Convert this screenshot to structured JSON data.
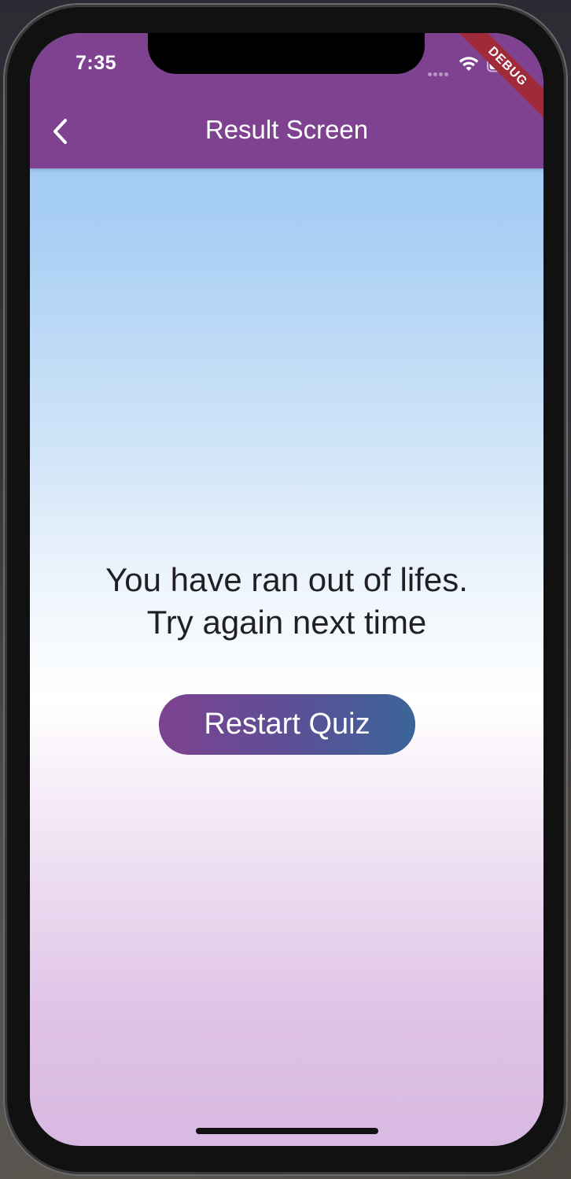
{
  "status_bar": {
    "time": "7:35"
  },
  "debug_banner": "DEBUG",
  "appbar": {
    "title": "Result Screen",
    "back_icon": "chevron-left-icon"
  },
  "message": {
    "line1": "You have ran out of lifes.",
    "line2": "Try again next time"
  },
  "restart_button": {
    "label": "Restart Quiz"
  },
  "colors": {
    "appbar": "#7e4290",
    "button_start": "#7e4290",
    "button_end": "#3a6698",
    "background_top": "#99c5f2",
    "background_bottom": "#d8b9e2"
  }
}
